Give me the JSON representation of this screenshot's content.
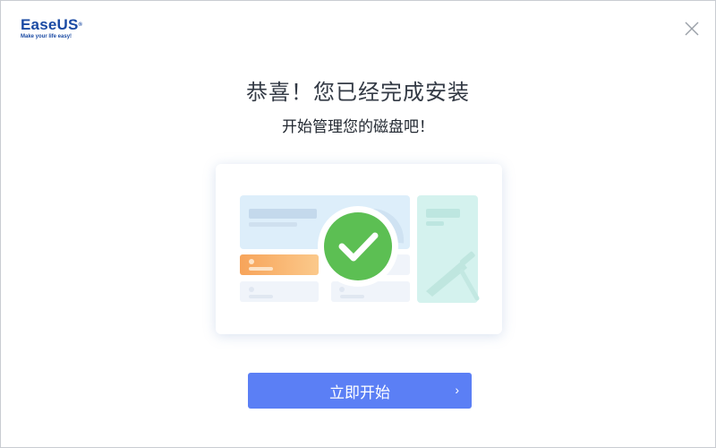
{
  "logo": {
    "brand": "EaseUS",
    "registered": "®",
    "tagline": "Make your life easy!"
  },
  "window": {
    "close_icon": "close-icon"
  },
  "main": {
    "title": "恭喜！您已经完成安装",
    "subtitle": "开始管理您的磁盘吧！"
  },
  "illustration": {
    "icon": "checkmark-circle-icon",
    "accent": "#5cbf53"
  },
  "actions": {
    "start_label": "立即开始",
    "start_arrow": "›",
    "button_color": "#5b7ff5"
  }
}
